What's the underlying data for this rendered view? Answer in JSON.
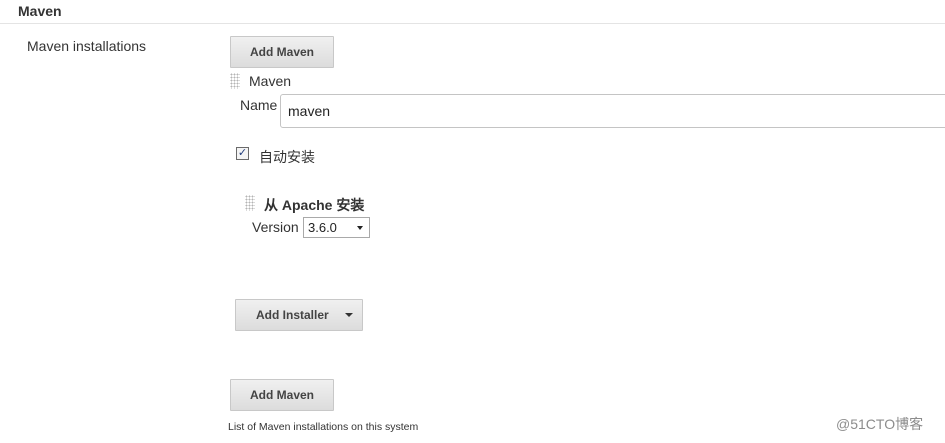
{
  "section": {
    "title": "Maven"
  },
  "maven_installations": {
    "label": "Maven installations",
    "add_button_label": "Add Maven",
    "entry": {
      "title": "Maven",
      "name_label": "Name",
      "name_value": "maven",
      "auto_install_label": "自动安装",
      "auto_install_checked": true,
      "installer": {
        "title": "从 Apache 安装",
        "version_label": "Version",
        "version_selected": "3.6.0"
      },
      "add_installer_label": "Add Installer"
    },
    "add_button_bottom_label": "Add Maven",
    "help_text": "List of Maven installations on this system"
  },
  "watermark": "@51CTO博客"
}
